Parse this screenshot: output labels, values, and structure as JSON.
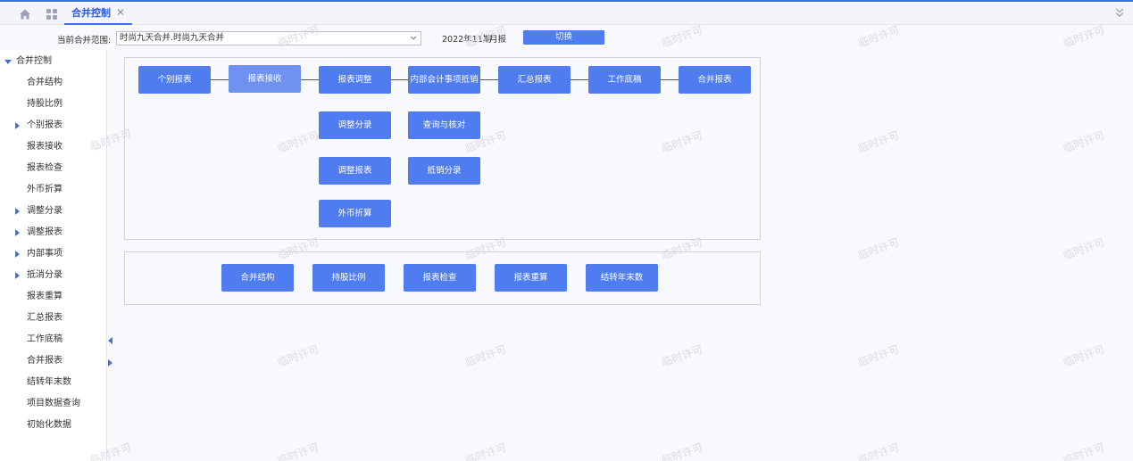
{
  "tabs": [
    {
      "label": "合并控制",
      "close": "✕"
    }
  ],
  "toolbar": {
    "range_label": "当前合并范围:",
    "range_value": "时尚九天合并.时尚九天合并",
    "period": "2022年11期",
    "period_type": "月报",
    "switch_label": "切换"
  },
  "sidebar": {
    "items": [
      {
        "label": "合并控制"
      },
      {
        "label": "合并结构"
      },
      {
        "label": "持股比例"
      },
      {
        "label": "个别报表"
      },
      {
        "label": "报表接收"
      },
      {
        "label": "报表检查"
      },
      {
        "label": "外币折算"
      },
      {
        "label": "调整分录"
      },
      {
        "label": "调整报表"
      },
      {
        "label": "内部事项"
      },
      {
        "label": "抵消分录"
      },
      {
        "label": "报表重算"
      },
      {
        "label": "汇总报表"
      },
      {
        "label": "工作底稿"
      },
      {
        "label": "合并报表"
      },
      {
        "label": "结转年末数"
      },
      {
        "label": "项目数据查询"
      },
      {
        "label": "初始化数据"
      }
    ]
  },
  "flow": {
    "main": [
      "个别报表",
      "报表接收",
      "报表调整",
      "内部会计事项抵销",
      "汇总报表",
      "工作底稿",
      "合并报表"
    ],
    "sub1": [
      "调整分录",
      "查询与核对"
    ],
    "sub2": [
      "调整报表",
      "抵销分录"
    ],
    "sub3": [
      "外币折算"
    ]
  },
  "bottom": [
    "合并结构",
    "持股比例",
    "报表检查",
    "报表重算",
    "结转年末数"
  ],
  "watermark": "临时许可",
  "colors": {
    "accent": "#3f6fe8",
    "button": "#4f7cf0"
  }
}
